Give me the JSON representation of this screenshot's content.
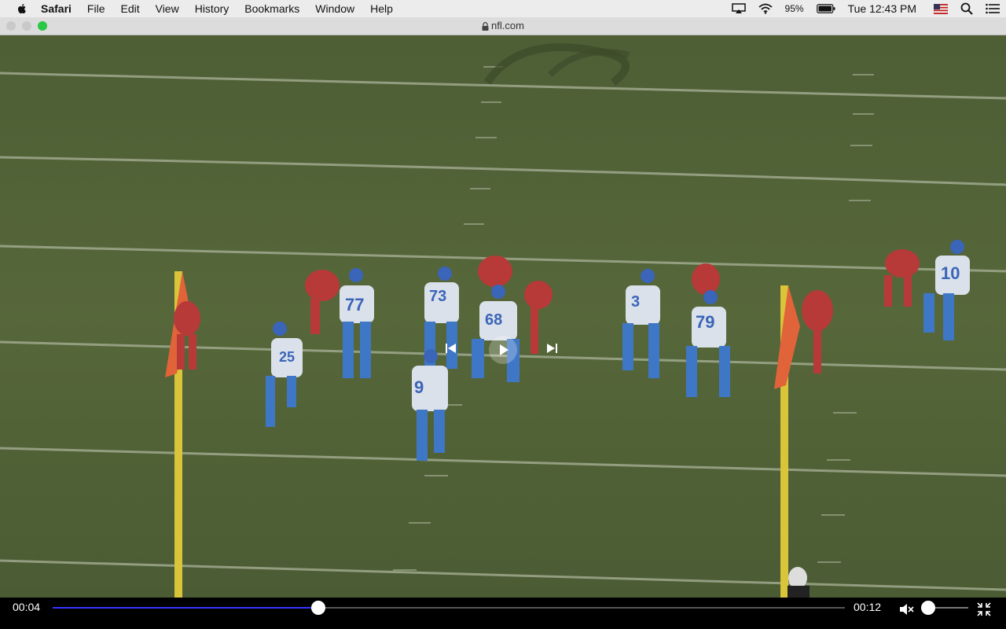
{
  "menubar": {
    "app_name": "Safari",
    "items": [
      "File",
      "Edit",
      "View",
      "History",
      "Bookmarks",
      "Window",
      "Help"
    ],
    "battery_percent": "95%",
    "clock": "Tue 12:43 PM"
  },
  "titlebar": {
    "url": "nfl.com"
  },
  "player": {
    "current_time": "00:04",
    "total_time": "00:12",
    "progress": 0.335,
    "volume": 0.15,
    "muted": true,
    "accent_color": "#3434ff"
  },
  "jerseys": [
    "77",
    "73",
    "68",
    "79",
    "3",
    "10",
    "25",
    "9"
  ]
}
